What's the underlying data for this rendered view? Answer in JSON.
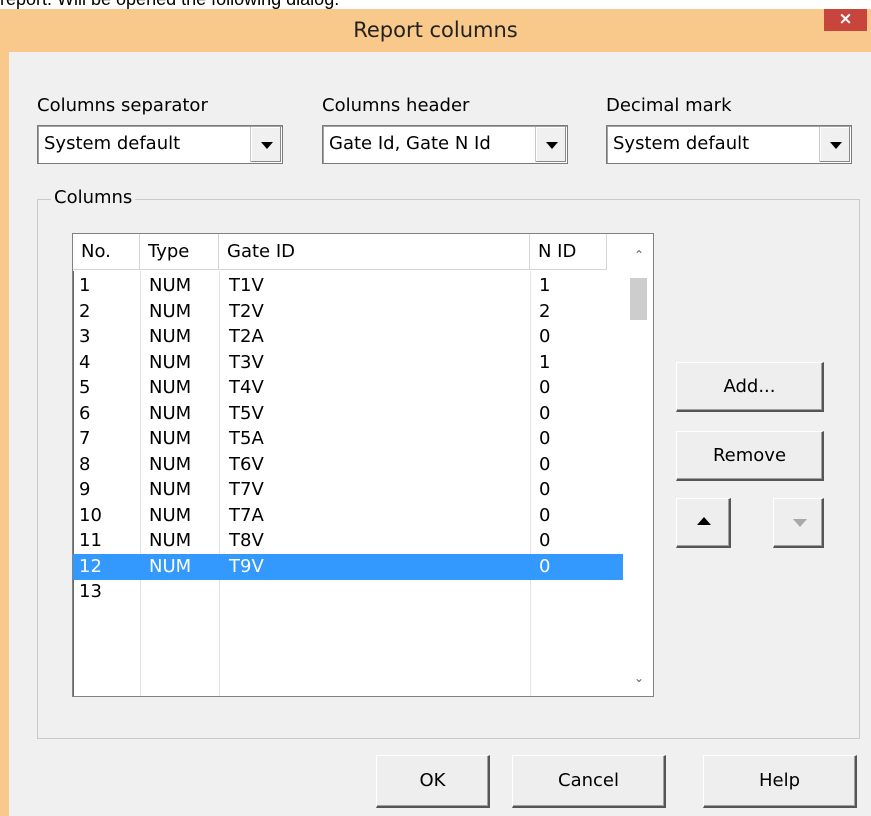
{
  "context_text": "report. Will be opened the following dialog:",
  "dialog": {
    "title": "Report columns",
    "close_glyph": "×"
  },
  "top_fields": {
    "separator": {
      "label": "Columns separator",
      "value": "System default"
    },
    "header": {
      "label": "Columns header",
      "value": "Gate Id, Gate N Id"
    },
    "decimal": {
      "label": "Decimal mark",
      "value": "System default"
    }
  },
  "columns_group": {
    "label": "Columns",
    "headers": [
      "No.",
      "Type",
      "Gate ID",
      "N ID"
    ],
    "rows": [
      {
        "no": "1",
        "type": "NUM",
        "gate": "T1V",
        "nid": "1"
      },
      {
        "no": "2",
        "type": "NUM",
        "gate": "T2V",
        "nid": "2"
      },
      {
        "no": "3",
        "type": "NUM",
        "gate": "T2A",
        "nid": "0"
      },
      {
        "no": "4",
        "type": "NUM",
        "gate": "T3V",
        "nid": "1"
      },
      {
        "no": "5",
        "type": "NUM",
        "gate": "T4V",
        "nid": "0"
      },
      {
        "no": "6",
        "type": "NUM",
        "gate": "T5V",
        "nid": "0"
      },
      {
        "no": "7",
        "type": "NUM",
        "gate": "T5A",
        "nid": "0"
      },
      {
        "no": "8",
        "type": "NUM",
        "gate": "T6V",
        "nid": "0"
      },
      {
        "no": "9",
        "type": "NUM",
        "gate": "T7V",
        "nid": "0"
      },
      {
        "no": "10",
        "type": "NUM",
        "gate": "T7A",
        "nid": "0"
      },
      {
        "no": "11",
        "type": "NUM",
        "gate": "T8V",
        "nid": "0"
      },
      {
        "no": "12",
        "type": "NUM",
        "gate": "T9V",
        "nid": "0"
      },
      {
        "no": "13",
        "type": "",
        "gate": "",
        "nid": ""
      }
    ],
    "selected_row": 11
  },
  "side_buttons": {
    "add": "Add...",
    "remove": "Remove",
    "move_up_icon": "triangle-up",
    "move_down_icon": "triangle-down"
  },
  "footer_buttons": {
    "ok": "OK",
    "cancel": "Cancel",
    "help": "Help"
  },
  "colors": {
    "frame": "#f8c98b",
    "close": "#c7453d",
    "selection": "#3399ff"
  }
}
